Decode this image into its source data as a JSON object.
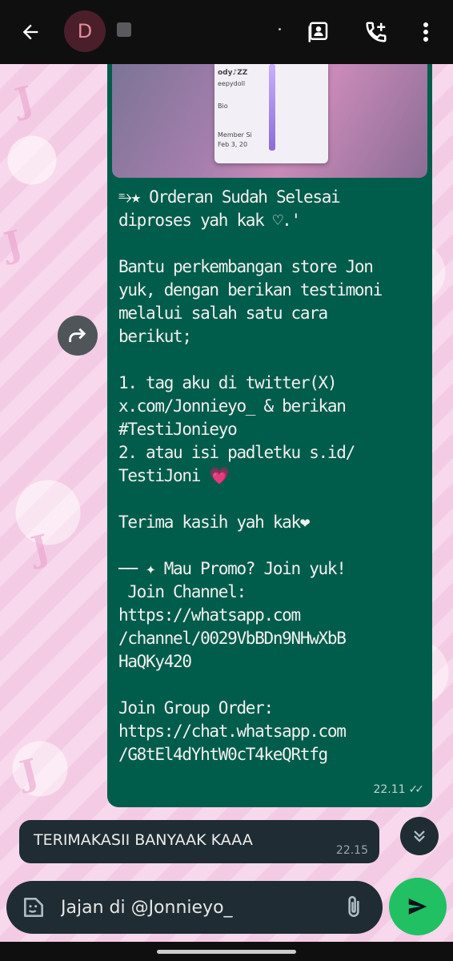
{
  "header": {
    "avatar_letter": "D",
    "back_icon": "arrow-left-icon",
    "contact_icon": "contact-card-icon",
    "call_icon": "add-call-icon",
    "menu_icon": "more-vert-icon"
  },
  "media_preview": {
    "card_name": "ody♪ZZ",
    "card_handle": "eepydoll",
    "card_bio": "Bio",
    "card_member": "Member Si",
    "card_date": "Feb 3, 20"
  },
  "outgoing_message": {
    "text": "⥱★ Orderan Sudah Selesai\ndiproses yah kak ♡.'\n\nBantu perkembangan store Jon\nyuk, dengan berikan testimoni\nmelalui salah satu cara\nberikut;\n\n1. tag aku di twitter(X)\nx.com/Jonnieyo_ & berikan\n#TestiJonieyo\n2. atau isi padletku s.id/\nTestiJoni 💗\n\nTerima kasih yah kak❤\n\n── ✦ Mau Promo? Join yuk!\n Join Channel:\nhttps://whatsapp.com\n/channel/0029VbBDn9NHwXbB\nHaQKy420\n\nJoin Group Order:\nhttps://chat.whatsapp.com\n/G8tEl4dYhtW0cT4keQRtfg",
    "time": "22.11"
  },
  "incoming_message": {
    "text": "TERIMAKASII BANYAAK KAAA",
    "time": "22.15"
  },
  "composer": {
    "value": "Jajan di @Jonnieyo_",
    "emoji_icon": "sticker-icon",
    "attach_icon": "paperclip-icon",
    "send_icon": "send-icon"
  },
  "colors": {
    "outgoing_bubble": "#005c4b",
    "incoming_bubble": "#1f2c33",
    "send_button": "#21c063",
    "header": "#0f0f10"
  }
}
